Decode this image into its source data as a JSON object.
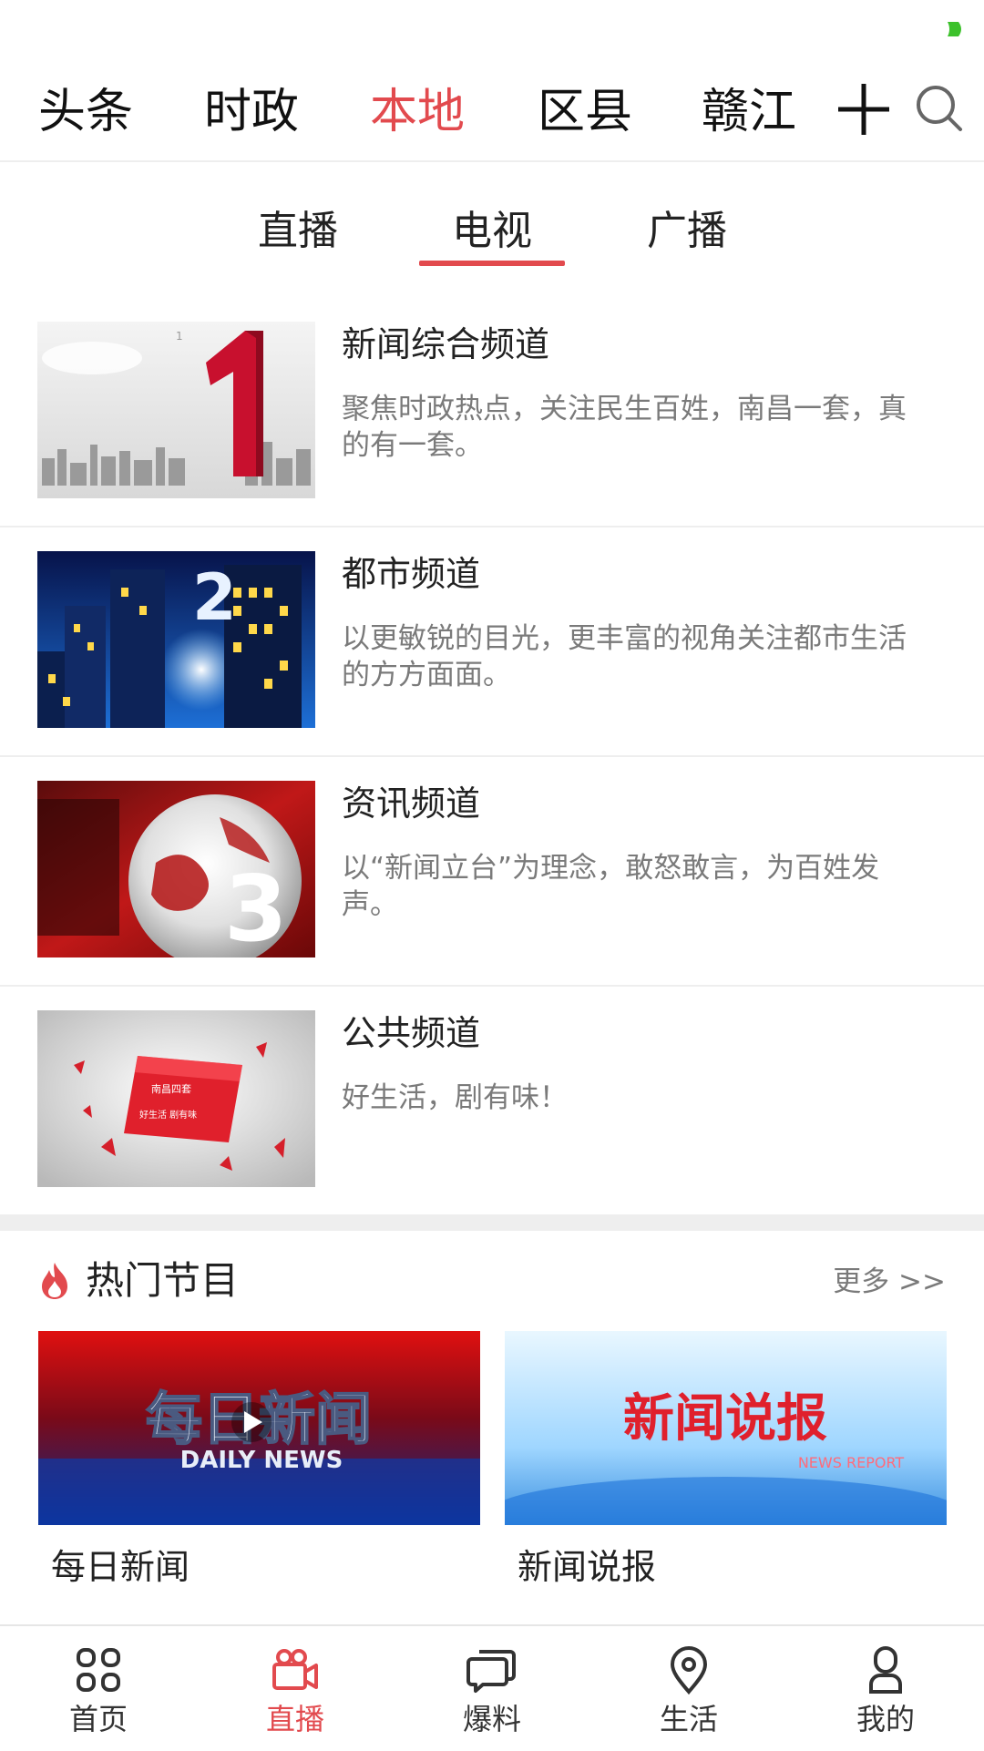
{
  "status_bar": {
    "indicator_color": "#3cc12b"
  },
  "top_nav": {
    "tabs": [
      {
        "label": "头条",
        "active": false
      },
      {
        "label": "时政",
        "active": false
      },
      {
        "label": "本地",
        "active": true
      },
      {
        "label": "区县",
        "active": false
      },
      {
        "label": "赣江",
        "active": false
      }
    ],
    "add_icon": "plus-icon",
    "search_icon": "search-icon"
  },
  "sub_tabs": [
    {
      "label": "直播",
      "active": false
    },
    {
      "label": "电视",
      "active": true
    },
    {
      "label": "广播",
      "active": false
    }
  ],
  "channels": [
    {
      "title": "新闻综合频道",
      "desc": "聚焦时政热点，关注民生百姓，南昌一套，真的有一套。",
      "thumb_text": "1"
    },
    {
      "title": "都市频道",
      "desc": "以更敏锐的目光，更丰富的视角关注都市生活的方方面面。",
      "thumb_text": "2"
    },
    {
      "title": "资讯频道",
      "desc": "以“新闻立台”为理念，敢怒敢言，为百姓发声。",
      "thumb_text": "3"
    },
    {
      "title": "公共频道",
      "desc": "好生活，剧有味！",
      "thumb_text": "南昌四套",
      "thumb_subtext": "好生活 剧有味"
    }
  ],
  "hot": {
    "title": "热门节目",
    "more": "更多 >>",
    "programs": [
      {
        "label": "每日新闻",
        "art_title": "每日新闻",
        "art_sub": "DAILY NEWS"
      },
      {
        "label": "新闻说报",
        "art_title": "新闻说报",
        "art_sub": "NEWS REPORT"
      }
    ]
  },
  "bottom_nav": [
    {
      "label": "首页",
      "icon": "grid-icon",
      "active": false
    },
    {
      "label": "直播",
      "icon": "video-camera-icon",
      "active": true
    },
    {
      "label": "爆料",
      "icon": "chat-bubble-icon",
      "active": false
    },
    {
      "label": "生活",
      "icon": "location-pin-icon",
      "active": false
    },
    {
      "label": "我的",
      "icon": "user-icon",
      "active": false
    }
  ],
  "colors": {
    "accent": "#e24a4e",
    "text": "#222222",
    "muted": "#7a7a7a",
    "divider": "#eeeeee"
  }
}
